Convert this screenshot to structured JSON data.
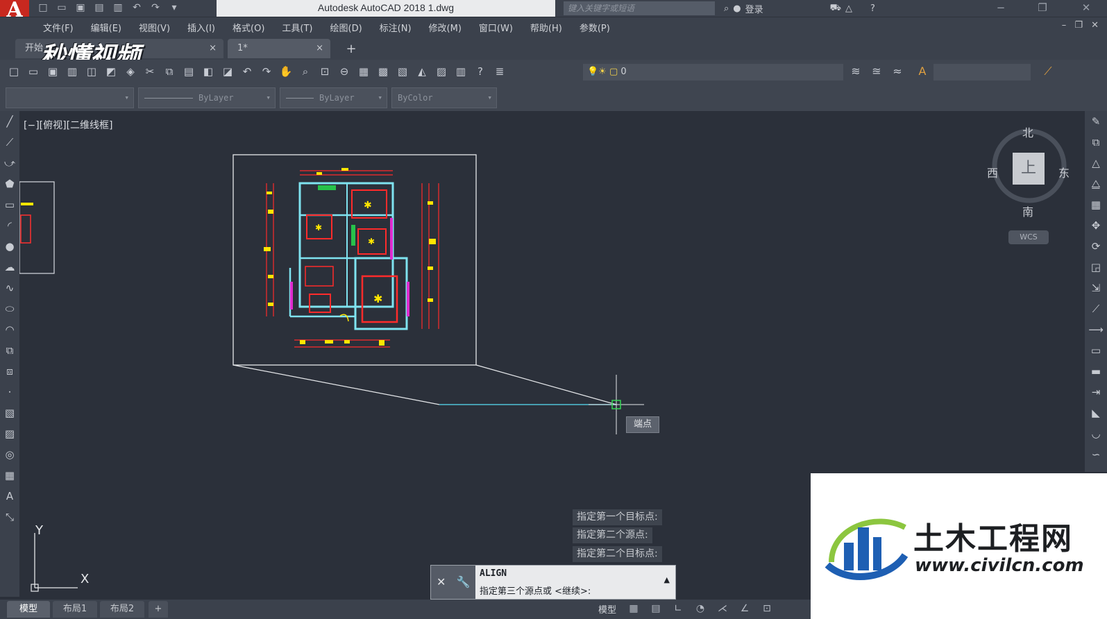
{
  "app": {
    "logo_letter": "A",
    "title": "Autodesk AutoCAD 2018    1.dwg",
    "search_placeholder": "键入关键字或短语",
    "login": "登录",
    "window_controls": [
      "−",
      "❐",
      "✕"
    ],
    "mdi_controls": "– ❐ ✕"
  },
  "menu": [
    "文件(F)",
    "编辑(E)",
    "视图(V)",
    "插入(I)",
    "格式(O)",
    "工具(T)",
    "绘图(D)",
    "标注(N)",
    "修改(M)",
    "窗口(W)",
    "帮助(H)",
    "参数(P)"
  ],
  "tabs": {
    "start": "开始",
    "doc": "1*",
    "close": "×",
    "add": "+"
  },
  "watermark": "秒懂视频",
  "toolbar": {
    "layer_value": "0",
    "linetype": "ByLayer",
    "lineweight": "ByLayer",
    "color": "ByColor"
  },
  "viewport": {
    "label": "[−][俯视][二维线框]"
  },
  "viewcube": {
    "north": "北",
    "south": "南",
    "west": "西",
    "east": "东",
    "face": "上",
    "wcs": "WCS"
  },
  "ucs": {
    "x": "X",
    "y": "Y"
  },
  "tooltip": "端点",
  "command": {
    "history": [
      "指定第一个目标点:",
      "指定第二个源点:",
      "指定第二个目标点:"
    ],
    "name": "ALIGN",
    "prompt": "指定第三个源点或 <继续>:",
    "close": "✕"
  },
  "layout_tabs": [
    "模型",
    "布局1",
    "布局2",
    "+"
  ],
  "status": {
    "model": "模型"
  },
  "site_logo": {
    "name": "土木工程网",
    "url": "www.civilcn.com"
  },
  "colors": {
    "canvas": "#2b303a",
    "accent_red": "#c8281f",
    "cyan": "#7fe3f0",
    "cad_red": "#ff2b2b",
    "cad_yellow": "#ffe600"
  }
}
